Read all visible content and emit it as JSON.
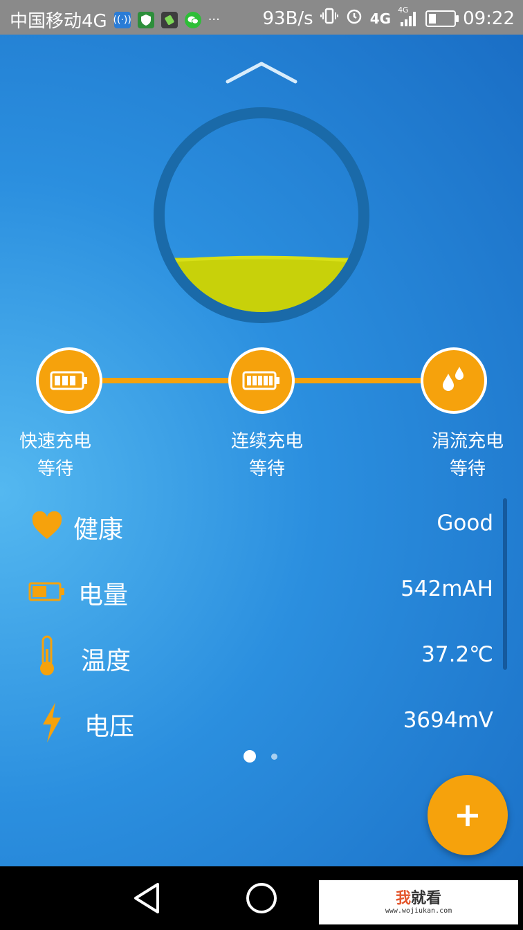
{
  "status_bar": {
    "carrier": "中国移动4G",
    "more": "···",
    "net_speed": "93B/s",
    "network": "4G",
    "signal_label": "4G",
    "time": "09:22"
  },
  "gauge": {
    "fill_level": 0.28,
    "fill_color": "#c8d10a",
    "ring_color": "#1a6aa9"
  },
  "stages": [
    {
      "title": "快速充电",
      "status": "等待",
      "icon": "battery-fast-icon"
    },
    {
      "title": "连续充电",
      "status": "等待",
      "icon": "battery-full-icon"
    },
    {
      "title": "涓流充电",
      "status": "等待",
      "icon": "water-drops-icon"
    }
  ],
  "stats": [
    {
      "label": "健康",
      "value": "Good",
      "icon": "heart-icon"
    },
    {
      "label": "电量",
      "value": "542mAH",
      "icon": "battery-level-icon"
    },
    {
      "label": "温度",
      "value": "37.2℃",
      "icon": "thermometer-icon"
    },
    {
      "label": "电压",
      "value": "3694mV",
      "icon": "lightning-icon"
    }
  ],
  "pager": {
    "current": 1,
    "total": 2
  },
  "fab": {
    "label": "+"
  },
  "watermark": {
    "title_accent": "我",
    "title_rest": "就看",
    "url": "www.wojiukan.com"
  },
  "colors": {
    "accent": "#f6a20c",
    "background_top": "#2b8fdf",
    "background_light": "#54b8f0"
  }
}
